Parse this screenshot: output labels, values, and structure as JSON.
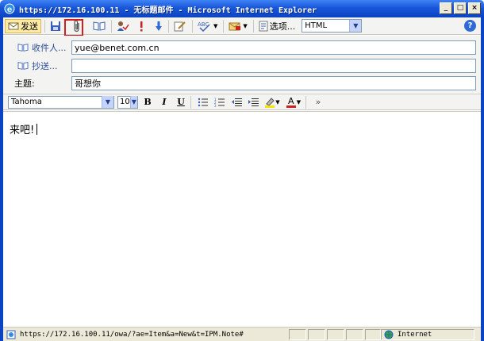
{
  "window": {
    "title": "https://172.16.100.11 - 无标题邮件 - Microsoft Internet Explorer",
    "controls": [
      "_",
      "□",
      "×"
    ]
  },
  "toolbar": {
    "send_label": "发送",
    "options_label": "选项...",
    "format_value": "HTML",
    "help_label": "?"
  },
  "fields": {
    "to_label": "收件人...",
    "to_value": "yue@benet.com.cn",
    "cc_label": "抄送...",
    "cc_value": "",
    "subject_label": "主题:",
    "subject_value": "哥想你"
  },
  "format_toolbar": {
    "font": "Tahoma",
    "size": "10",
    "bold": "B",
    "italic": "I",
    "underline": "U",
    "font_color": "A",
    "more": "»"
  },
  "body": {
    "text": "来吧!"
  },
  "statusbar": {
    "url": "https://172.16.100.11/owa/?ae=Item&a=New&t=IPM.Note#",
    "zone": "Internet"
  },
  "colors": {
    "title_blue": "#0b44c2",
    "highlight_red": "#d21e1e",
    "send_bg": "#fde9a8"
  }
}
